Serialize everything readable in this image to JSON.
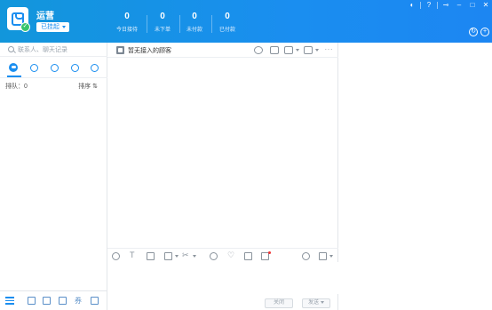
{
  "header": {
    "app_name": "运营",
    "status_label": "已挂起",
    "stats": [
      {
        "value": "0",
        "label": "今日接待"
      },
      {
        "value": "0",
        "label": "未下单"
      },
      {
        "value": "0",
        "label": "未付款"
      },
      {
        "value": "0",
        "label": "已付款"
      }
    ],
    "colors": {
      "accent": "#1a8ef0",
      "online": "#36c56c"
    }
  },
  "left_panel": {
    "search_placeholder": "联系人、聊天记录",
    "tabs": [
      "chat-icon",
      "clock-icon",
      "contact-icon",
      "group-icon",
      "org-icon"
    ],
    "queue_label": "排队：0",
    "sort_label": "排序 ⇅",
    "bottom_icons": [
      "menu-icon",
      "inbox-icon",
      "mail-icon",
      "archive-icon",
      "coupon-icon",
      "window-icon"
    ]
  },
  "chat_panel": {
    "title": "暂无接入的顾客",
    "close_label": "关闭",
    "send_label": "发送"
  }
}
